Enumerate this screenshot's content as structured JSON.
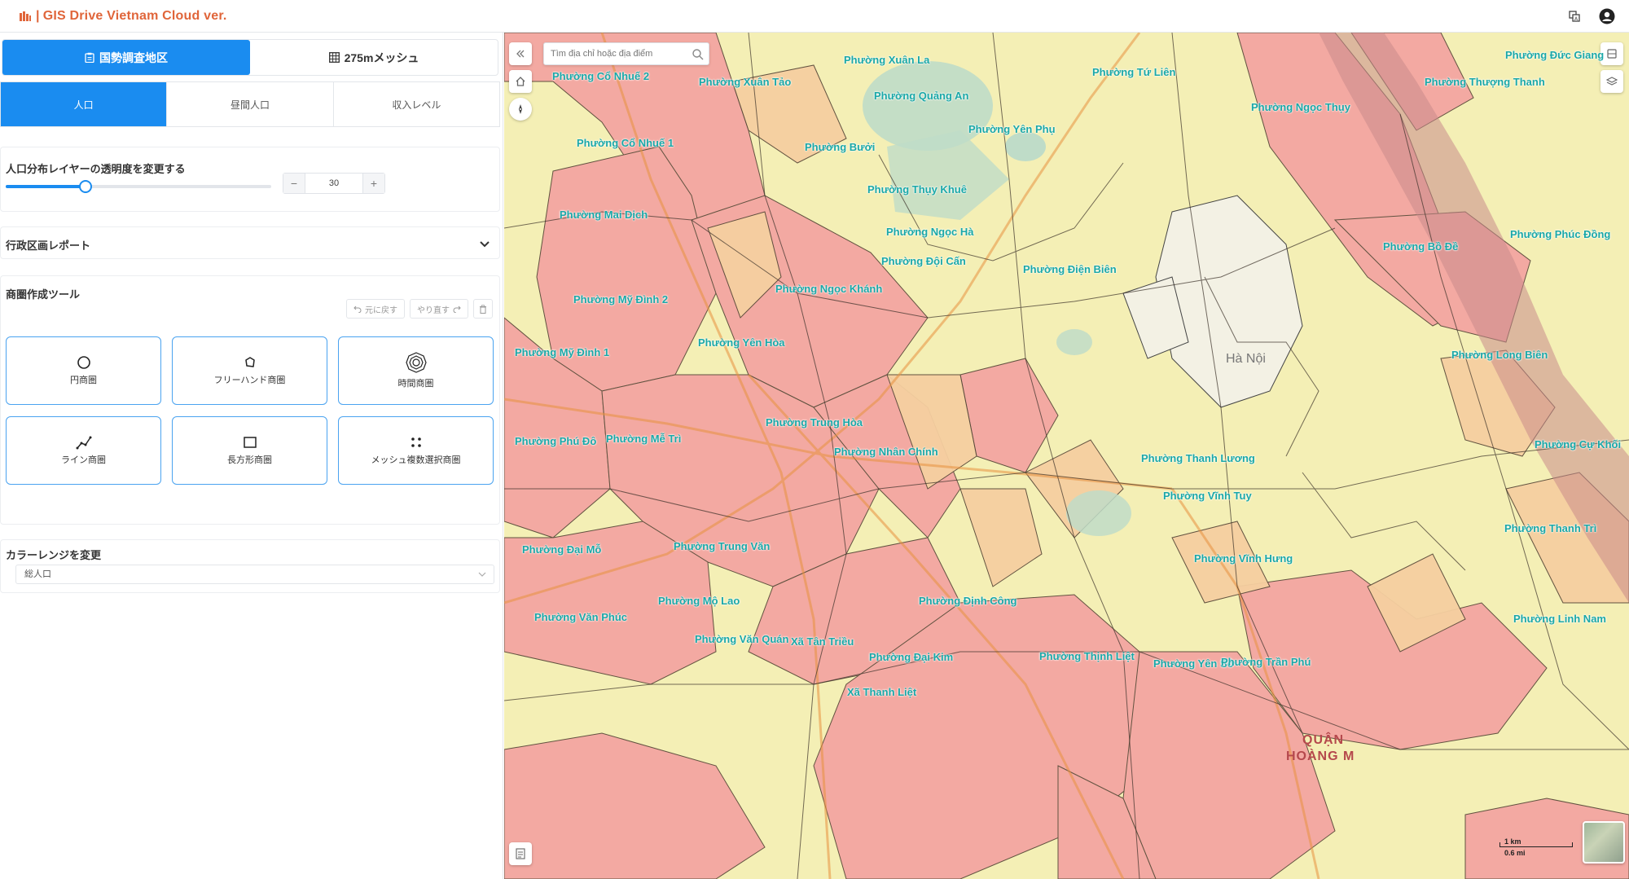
{
  "app": {
    "logo_text": "GIS Drive Vietnam Cloud ver.",
    "brand_color": "#e0653a"
  },
  "sidebar": {
    "main_tabs": [
      {
        "label": "国勢調査地区",
        "icon": "clipboard-icon",
        "active": true
      },
      {
        "label": "275mメッシュ",
        "icon": "grid-icon",
        "active": false
      }
    ],
    "sub_tabs": [
      {
        "label": "人口",
        "active": true
      },
      {
        "label": "昼間人口",
        "active": false
      },
      {
        "label": "収入レベル",
        "active": false
      }
    ],
    "opacity": {
      "title": "人口分布レイヤーの透明度を変更する",
      "value": "30",
      "fraction": 0.3,
      "minus": "−",
      "plus": "+"
    },
    "report": {
      "title": "行政区画レポート"
    },
    "tools": {
      "title": "商圏作成ツール",
      "undo": "元に戻す",
      "redo": "やり直す",
      "items": [
        {
          "label": "円商圏",
          "icon": "circle-icon"
        },
        {
          "label": "フリーハンド商圏",
          "icon": "freehand-icon"
        },
        {
          "label": "時間商圏",
          "icon": "isochrone-icon"
        },
        {
          "label": "ライン商圏",
          "icon": "line-icon"
        },
        {
          "label": "長方形商圏",
          "icon": "rectangle-icon"
        },
        {
          "label": "メッシュ複数選択商圏",
          "icon": "mesh-select-icon"
        }
      ]
    },
    "color_range": {
      "title": "カラーレンジを変更",
      "selected": "総人口"
    }
  },
  "map": {
    "search_placeholder": "Tìm địa chỉ hoặc địa điểm",
    "city_label": "Hà Nội",
    "district_label_line1": "QUẬN",
    "district_label_line2": "HOÀNG M",
    "scale_km": "1 km",
    "scale_mi": "0.6 mi",
    "colors": {
      "high": "#f3a6a1",
      "mid": "#f6cfa0",
      "low": "#f4efb5",
      "lowest": "#f3f1e4",
      "water": "#bfdcc8",
      "river": "#9fcfb8",
      "label": "#1aa8a8"
    },
    "labels": [
      "Phường Xuân La",
      "Phường Tứ Liên",
      "Phường Đức Giang",
      "Phường Cổ Nhuế 2",
      "Phường Xuân Tảo",
      "Phường Quảng An",
      "Phường Thượng Thanh",
      "Phường Ngọc Thụy",
      "Phường Cổ Nhuế 1",
      "Phường Bưởi",
      "Phường Yên Phụ",
      "Phường Thụy Khuê",
      "Phường Mai Dịch",
      "Phường Ngọc Hà",
      "Phường Phúc Đồng",
      "Phường Bồ Đề",
      "Phường Đội Cấn",
      "Phường Điện Biên",
      "Phường Ngọc Khánh",
      "Phường Mỹ Đình 2",
      "Phường Yên Hòa",
      "Phường Mỹ Đình 1",
      "Phường Long Biên",
      "Phường Trung Hòa",
      "Phường Phú Đô",
      "Phường Mễ Trì",
      "Phường Nhân Chính",
      "Phường Cự Khối",
      "Phường Thanh Lương",
      "Phường Vĩnh Tuy",
      "Phường Trung Văn",
      "Phường Đại Mỗ",
      "Phường Thanh Trì",
      "Phường Vĩnh Hưng",
      "Phường Mộ Lao",
      "Phường Định Công",
      "Phường Văn Phúc",
      "Phường Linh Nam",
      "Phường Văn Quán",
      "Xã Tân Triều",
      "Phường Đại Kim",
      "Phường Thịnh Liệt",
      "Phường Yên Sở",
      "Phường Trần Phú",
      "Xã Thanh Liệt"
    ]
  }
}
